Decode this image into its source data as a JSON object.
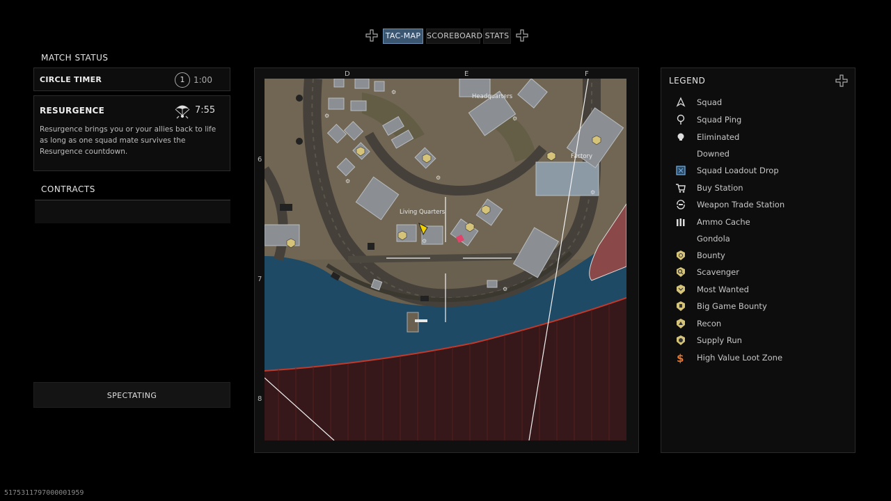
{
  "tabs": {
    "items": [
      {
        "label": "TAC-MAP",
        "active": true
      },
      {
        "label": "SCOREBOARD",
        "active": false
      },
      {
        "label": "STATS",
        "active": false
      }
    ],
    "left_icon": "dpad-left-icon",
    "right_icon": "dpad-right-icon"
  },
  "match_status": {
    "title": "MATCH STATUS",
    "circle_timer": {
      "label": "CIRCLE TIMER",
      "circle_number": "1",
      "time": "1:00"
    },
    "resurgence": {
      "label": "RESURGENCE",
      "icon": "parachute-icon",
      "time": "7:55",
      "description": "Resurgence brings you or your allies back to life as long as one squad mate survives the Resurgence countdown."
    }
  },
  "contracts": {
    "title": "CONTRACTS"
  },
  "spectating": {
    "label": "SPECTATING"
  },
  "match_id": "5175311797000001959",
  "map": {
    "columns": [
      "D",
      "E",
      "F"
    ],
    "rows": [
      "6",
      "7",
      "8"
    ],
    "locations": [
      {
        "name": "Headquarters"
      },
      {
        "name": "Factory"
      },
      {
        "name": "Living Quarters"
      }
    ],
    "colors": {
      "water": "#1f4a66",
      "gas_zone": "#3a1414",
      "circle_edge": "#c0392b",
      "land": "#6d6354",
      "road": "#4a463f"
    }
  },
  "legend": {
    "title": "LEGEND",
    "items": [
      {
        "label": "Squad",
        "icon": "squad-arrow-icon"
      },
      {
        "label": "Squad Ping",
        "icon": "ping-icon"
      },
      {
        "label": "Eliminated",
        "icon": "skull-icon"
      },
      {
        "label": "Downed",
        "icon": ""
      },
      {
        "label": "Squad Loadout Drop",
        "icon": "loadout-drop-icon"
      },
      {
        "label": "Buy Station",
        "icon": "cart-icon"
      },
      {
        "label": "Weapon Trade Station",
        "icon": "weapon-trade-icon"
      },
      {
        "label": "Ammo Cache",
        "icon": "ammo-icon"
      },
      {
        "label": "Gondola",
        "icon": ""
      },
      {
        "label": "Bounty",
        "icon": "bounty-icon"
      },
      {
        "label": "Scavenger",
        "icon": "scavenger-icon"
      },
      {
        "label": "Most Wanted",
        "icon": "most-wanted-icon"
      },
      {
        "label": "Big Game Bounty",
        "icon": "big-game-bounty-icon"
      },
      {
        "label": "Recon",
        "icon": "recon-icon"
      },
      {
        "label": "Supply Run",
        "icon": "supply-run-icon"
      },
      {
        "label": "High Value Loot Zone",
        "icon": "high-value-loot-icon"
      }
    ],
    "colors": {
      "contract_gold": "#d6c37a",
      "loadout_blue": "#6fa8dc",
      "high_value_orange": "#e8752c"
    }
  }
}
